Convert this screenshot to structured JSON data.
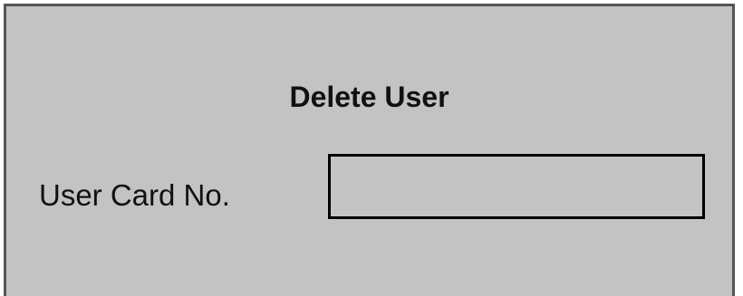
{
  "dialog": {
    "title": "Delete User",
    "card_number": {
      "label": "User Card No.",
      "value": "",
      "placeholder": ""
    }
  }
}
